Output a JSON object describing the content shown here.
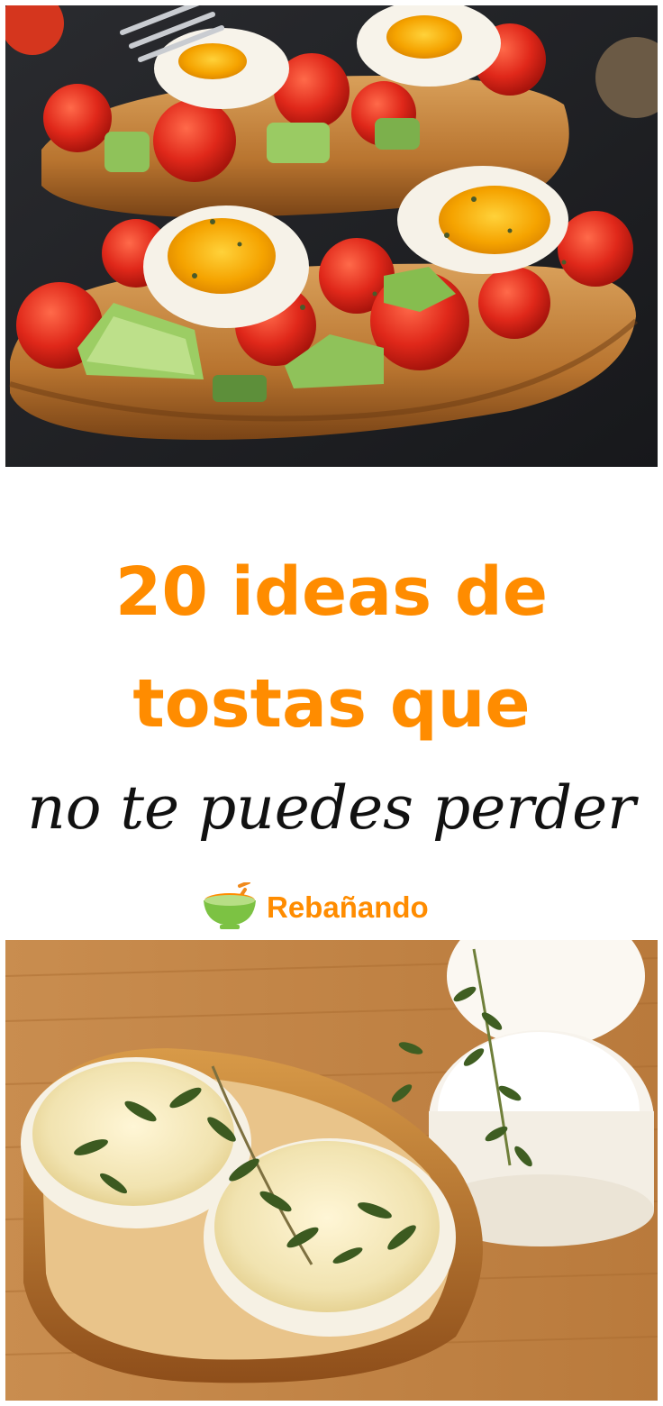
{
  "headline": {
    "line1": "20 ideas de",
    "line2": "tostas que",
    "subtitle": "no te puedes perder"
  },
  "brand": {
    "name": "Rebañando",
    "logo_icon": "salad-bowl-icon"
  },
  "images": {
    "top": "tomato-avocado-egg-toast-photo",
    "bottom": "goat-cheese-thyme-toast-photo"
  },
  "colors": {
    "accent": "#ff8c00",
    "script_text": "#111111",
    "brand_green": "#7cc243",
    "background": "#ffffff"
  }
}
